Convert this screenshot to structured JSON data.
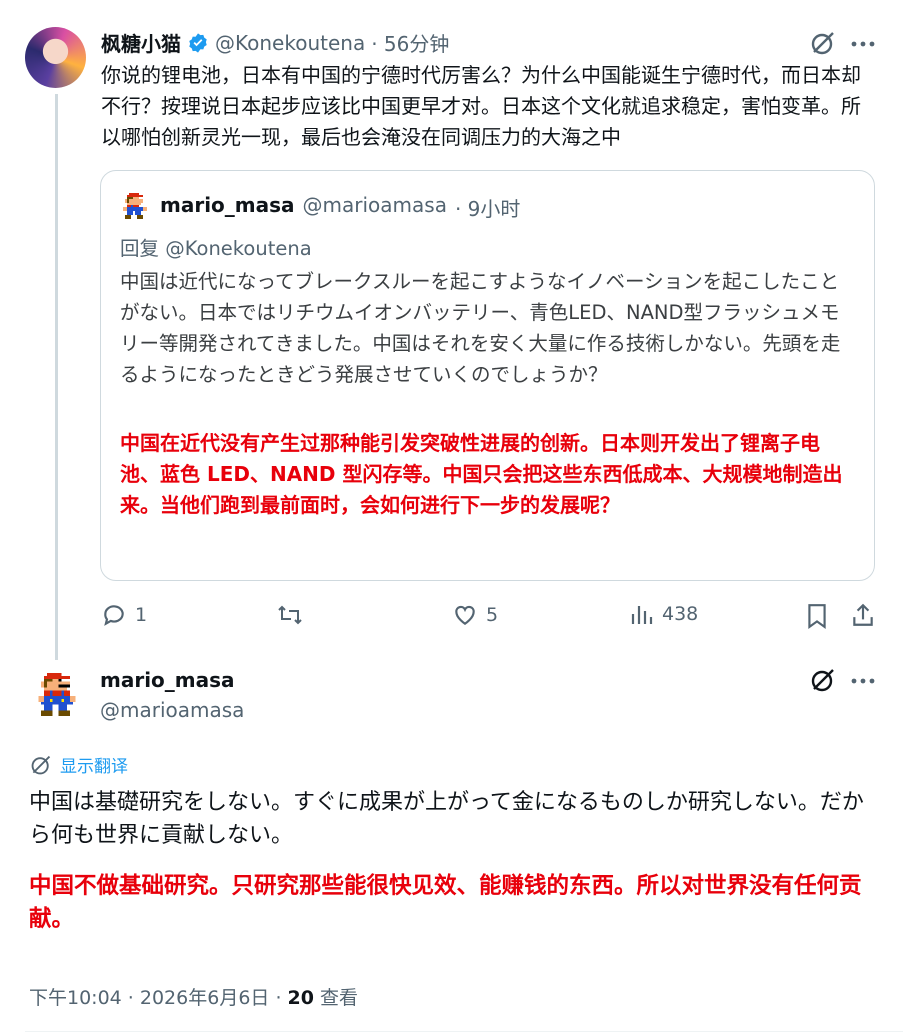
{
  "tweet1": {
    "name": "枫糖小猫",
    "handle": "@Konekoutena",
    "time": "· 56分钟",
    "text": "你说的锂电池，日本有中国的宁德时代厉害么？为什么中国能诞生宁德时代，而日本却不行？按理说日本起步应该比中国更早才对。日本这个文化就追求稳定，害怕变革。所以哪怕创新灵光一现，最后也会淹没在同调压力的大海之中",
    "quote": {
      "name": "mario_masa",
      "handle": "@marioamasa",
      "time": "· 9小时",
      "reply_to": "回复 @Konekoutena",
      "text": "中国は近代になってブレークスルーを起こすようなイノベーションを起こしたことがない。日本ではリチウムイオンバッテリー、青色LED、NAND型フラッシュメモリー等開発されてきました。中国はそれを安く大量に作る技術しかない。先頭を走るようになったときどう発展させていくのでしょうか？",
      "translation": "中国在近代没有产生过那种能引发突破性进展的创新。日本则开发出了锂离子电池、蓝色 LED、NAND 型闪存等。中国只会把这些东西低成本、大规模地制造出来。当他们跑到最前面时，会如何进行下一步的发展呢？"
    },
    "actions": {
      "replies": "1",
      "likes": "5",
      "views": "438"
    }
  },
  "tweet2": {
    "name": "mario_masa",
    "handle": "@marioamasa",
    "show_translation": "显示翻译",
    "text": "中国は基礎研究をしない。すぐに成果が上がって金になるものしか研究しない。だから何も世界に貢献しない。",
    "translation": "中国不做基础研究。只研究那些能很快见效、能赚钱的东西。所以对世界没有任何贡献。",
    "timestamp": "下午10:04 · 2026年6月6日 · ",
    "views_count": "20",
    "views_label": " 查看"
  },
  "colors": {
    "verified": "#1d9bf0",
    "red_text": "#e8000b",
    "grey": "#536471"
  }
}
